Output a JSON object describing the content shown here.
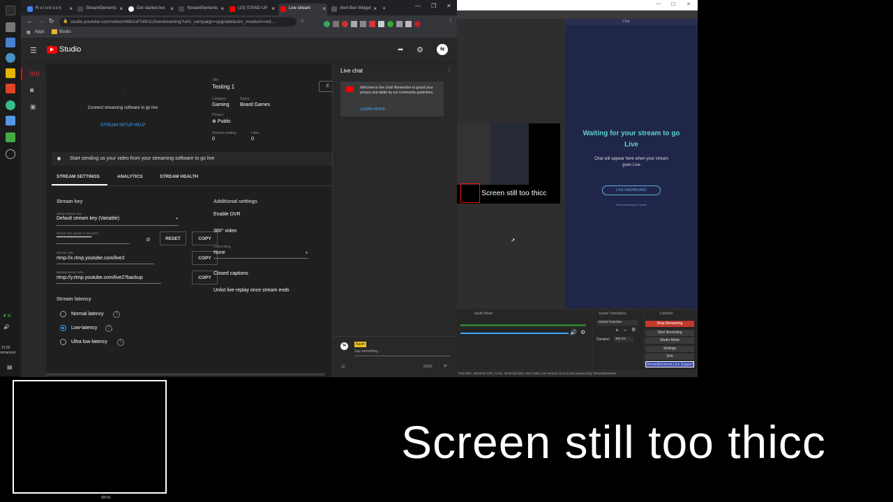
{
  "chrome": {
    "tabs": [
      {
        "label": "R u l e b o o k",
        "color": "#4285f4"
      },
      {
        "label": "StreamElements",
        "color": "#444444"
      },
      {
        "label": "Get started live",
        "color": "#ffffff"
      },
      {
        "label": "StreamElements",
        "color": "#444444"
      },
      {
        "label": "(15) STAND UP",
        "color": "#ff0000"
      },
      {
        "label": "Live stream",
        "color": "#ff0000"
      },
      {
        "label": "Alert Box Widget",
        "color": "#555555"
      }
    ],
    "url": "studio.youtube.com/video/nWb1xFnWr1c/livestreaming?utm_campaign=upgrade&utm_medium=red...",
    "bookmarks": [
      "Apps",
      "Books"
    ]
  },
  "studio": {
    "logo_text": "Studio",
    "preview": {
      "connect_text": "Connect streaming software to go live",
      "setup_help": "STREAM SETUP HELP"
    },
    "details": {
      "title_label": "Title",
      "title": "Testing 1",
      "category_label": "Category",
      "category": "Gaming",
      "game_label": "Game",
      "game": "Board Games",
      "privacy_label": "Privacy",
      "privacy": "Public",
      "viewers_label": "Viewers waiting",
      "viewers": "0",
      "likes_label": "Likes",
      "likes": "0",
      "edit_label": "E"
    },
    "status_text": "Start sending us your video from your streaming software to go live",
    "tabs": [
      "STREAM SETTINGS",
      "ANALYTICS",
      "STREAM HEALTH"
    ],
    "stream_key": {
      "heading": "Stream key",
      "select_label": "Select stream key",
      "select_value": "Default stream key (Variable)",
      "key_label": "Stream key (paste in encoder)",
      "key_value": "••••••••••••••••••••••••",
      "reset": "RESET",
      "copy": "COPY",
      "url_label": "Stream URL",
      "url_value": "rtmp://x.rtmp.youtube.com/live2",
      "backup_label": "Backup server URL",
      "backup_value": "rtmp://y.rtmp.youtube.com/live2?backup"
    },
    "latency": {
      "heading": "Stream latency",
      "options": [
        "Normal latency",
        "Low-latency",
        "Ultra low-latency"
      ],
      "selected": "Low-latency"
    },
    "additional": {
      "heading": "Additional settings",
      "dvr": "Enable DVR",
      "video360": "360° video",
      "delay_label": "Added delay",
      "delay_value": "None",
      "captions": "Closed captions",
      "unlist": "Unlist live replay once stream ends"
    }
  },
  "livechat": {
    "title": "Live chat",
    "welcome": "Welcome to live chat! Remember to guard your privacy and abide by our community guidelines.",
    "learn_more": "LEARN MORE",
    "user_badge": "Nazth",
    "input_placeholder": "Say something...",
    "counter": "0/200"
  },
  "obs": {
    "chat_dock_title": "Chat",
    "waiting_title": "Waiting for your stream to go Live",
    "waiting_sub": "Chat will appear here when your stream goes Live",
    "live_dashboard": "LIVE DASHBOARD",
    "stop_streaming_cancel": "Stop streaming to cancel",
    "preview_caption": "Screen still too thicc",
    "audio_mixer": "Audio Mixer",
    "scene_transitions": "Scene Transitions",
    "transition_value": "Global Transition",
    "duration_label": "Duration",
    "duration_value": "300 ms",
    "controls": "Controls",
    "controls_buttons": [
      "Stop Streaming",
      "Start Recording",
      "Studio Mode",
      "Settings",
      "Exit",
      "StreamElements Live Support"
    ],
    "status_bar": "0:04   REC: 00:00:00    CPU: 5.0%, 30.00 fps        kb/s: 2514   OBS.Live version 20.5.24.635 powered by StreamElements"
  },
  "overlay": {
    "caption": "Screen still too thicc",
    "webcam_label": "(00:0)"
  },
  "taskbar": {
    "clock": "21:02",
    "date": "30/09/2020"
  }
}
